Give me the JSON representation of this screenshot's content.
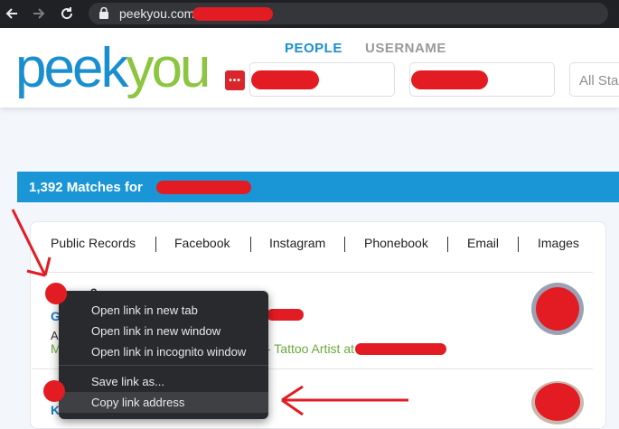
{
  "browser": {
    "url": "peekyou.com"
  },
  "site": {
    "logo_primary": "peek",
    "logo_secondary": "you",
    "badge_text": "•••",
    "tabs": [
      "PEOPLE",
      "USERNAME"
    ],
    "state_placeholder": "All Sta"
  },
  "results": {
    "matches_label": "1,392 Matches for",
    "filters": [
      "Public Records",
      "Facebook",
      "Instagram",
      "Phonebook",
      "Email",
      "Images"
    ],
    "row1": {
      "name_initial": "G",
      "name_suffix": "9",
      "line_initial": "A",
      "occupation_initial": "M",
      "occupation_text": "- Tattoo Artist at"
    },
    "row2": {
      "name_initial": "K"
    }
  },
  "context_menu": {
    "items": [
      "Open link in new tab",
      "Open link in new window",
      "Open link in incognito window",
      "Save link as...",
      "Copy link address"
    ],
    "highlighted_index": 4
  },
  "colors": {
    "brand_blue": "#1a8fcf",
    "brand_green": "#8cc540",
    "annotation_red": "#e31b23",
    "banner_blue": "#1a96d6"
  }
}
